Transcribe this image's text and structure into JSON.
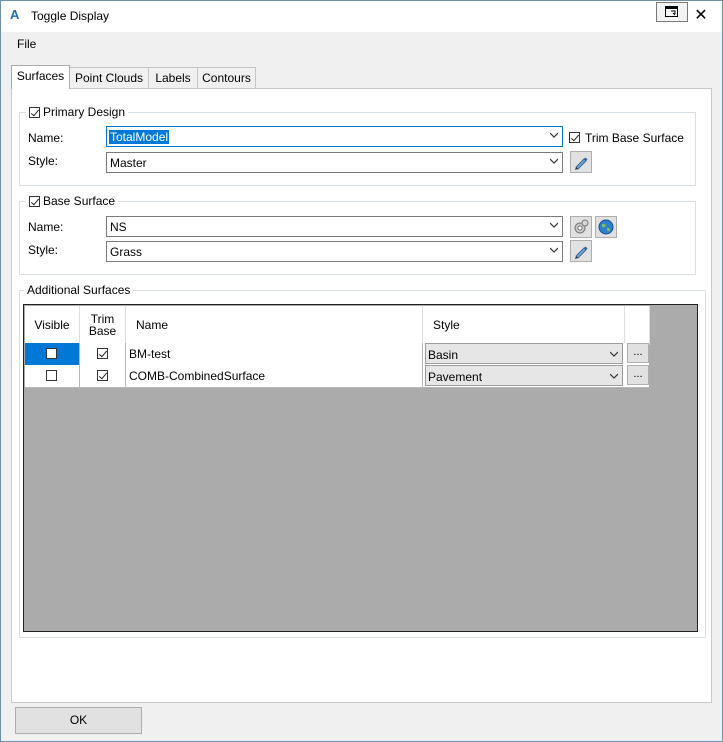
{
  "window": {
    "title": "Toggle Display",
    "app_icon_letter": "A",
    "accent_color": "#0078d7"
  },
  "menu": {
    "file": "File"
  },
  "tabs": [
    {
      "label": "Surfaces",
      "active": true
    },
    {
      "label": "Point Clouds",
      "active": false
    },
    {
      "label": "Labels",
      "active": false
    },
    {
      "label": "Contours",
      "active": false
    }
  ],
  "primary_design": {
    "label": "Primary Design",
    "checked": true,
    "name_label": "Name:",
    "name_value": "TotalModel",
    "style_label": "Style:",
    "style_value": "Master",
    "trim_label": "Trim Base Surface",
    "trim_checked": true,
    "edit_icon": "pencil-icon"
  },
  "base_surface": {
    "label": "Base Surface",
    "checked": true,
    "name_label": "Name:",
    "name_value": "NS",
    "style_label": "Style:",
    "style_value": "Grass",
    "icons": [
      "settings-gear-icon",
      "globe-icon",
      "pencil-icon"
    ]
  },
  "additional": {
    "label": "Additional Surfaces",
    "columns": {
      "visible": "Visible",
      "trim_base": "Trim Base",
      "name": "Name",
      "style": "Style"
    },
    "rows": [
      {
        "visible": false,
        "trim": true,
        "name": "BM-test",
        "style": "Basin",
        "more": "...",
        "selected": true
      },
      {
        "visible": false,
        "trim": true,
        "name": "COMB-CombinedSurface",
        "style": "Pavement",
        "more": "...",
        "selected": false
      }
    ],
    "grid_background": "#ababab"
  },
  "buttons": {
    "ok": "OK"
  }
}
